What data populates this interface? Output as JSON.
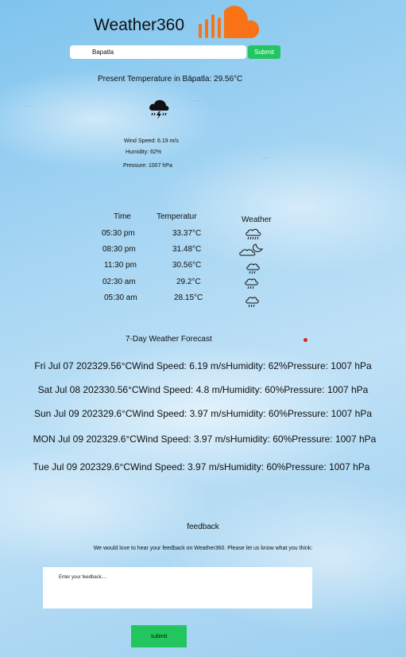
{
  "header": {
    "title": "Weather360",
    "logo_icon": "soundcloud-logo-icon",
    "accent": "#f97316"
  },
  "search": {
    "value": "Bapatla",
    "button_label": "Submit",
    "button_color": "#22c55e"
  },
  "current": {
    "heading": "Present Temperature in Bāpatla: 29.56°C",
    "icon": "thunderstorm-icon",
    "wind": "Wind Speed: 6.19 m/s",
    "humidity": "Humidity: 62%",
    "pressure": "Pressure: 1007 hPa"
  },
  "hourly": {
    "columns": [
      "Time",
      "Temperatur",
      "Weather"
    ],
    "rows": [
      {
        "time": "05:30 pm",
        "temp": "33.37°C",
        "icon": "heavy-rain-icon"
      },
      {
        "time": "08:30 pm",
        "temp": "31.48°C",
        "icon": "cloudy-night-icon"
      },
      {
        "time": "11:30 pm",
        "temp": "30.56°C",
        "icon": "rain-icon"
      },
      {
        "time": "02:30 am",
        "temp": "29.2°C",
        "icon": "rain-icon"
      },
      {
        "time": "05:30 am",
        "temp": "28.15°C",
        "icon": "rain-icon"
      }
    ]
  },
  "forecast": {
    "title": "7-Day Weather Forecast",
    "days": [
      "Fri Jul 07 202329.56°CWind Speed: 6.19 m/sHumidity: 62%Pressure: 1007 hPa",
      "Sat Jul 08 202330.56°CWind Speed: 4.8 m/Humidity: 60%Pressure: 1007 hPa",
      "Sun Jul 09 202329.6°CWind Speed: 3.97 m/sHumidity: 60%Pressure: 1007 hPa",
      "MON Jul 09 202329.6°CWind Speed: 3.97 m/sHumidity: 60%Pressure: 1007 hPa",
      "Tue Jul 09 202329.6°CWind Speed: 3.97 m/sHumidity: 60%Pressure: 1007 hPa"
    ]
  },
  "feedback": {
    "title": "feedback",
    "text": "We would love to hear your feedback on Weather360. Please let us know what you think:",
    "placeholder": "Enter your feedback....",
    "button_label": "submit"
  }
}
